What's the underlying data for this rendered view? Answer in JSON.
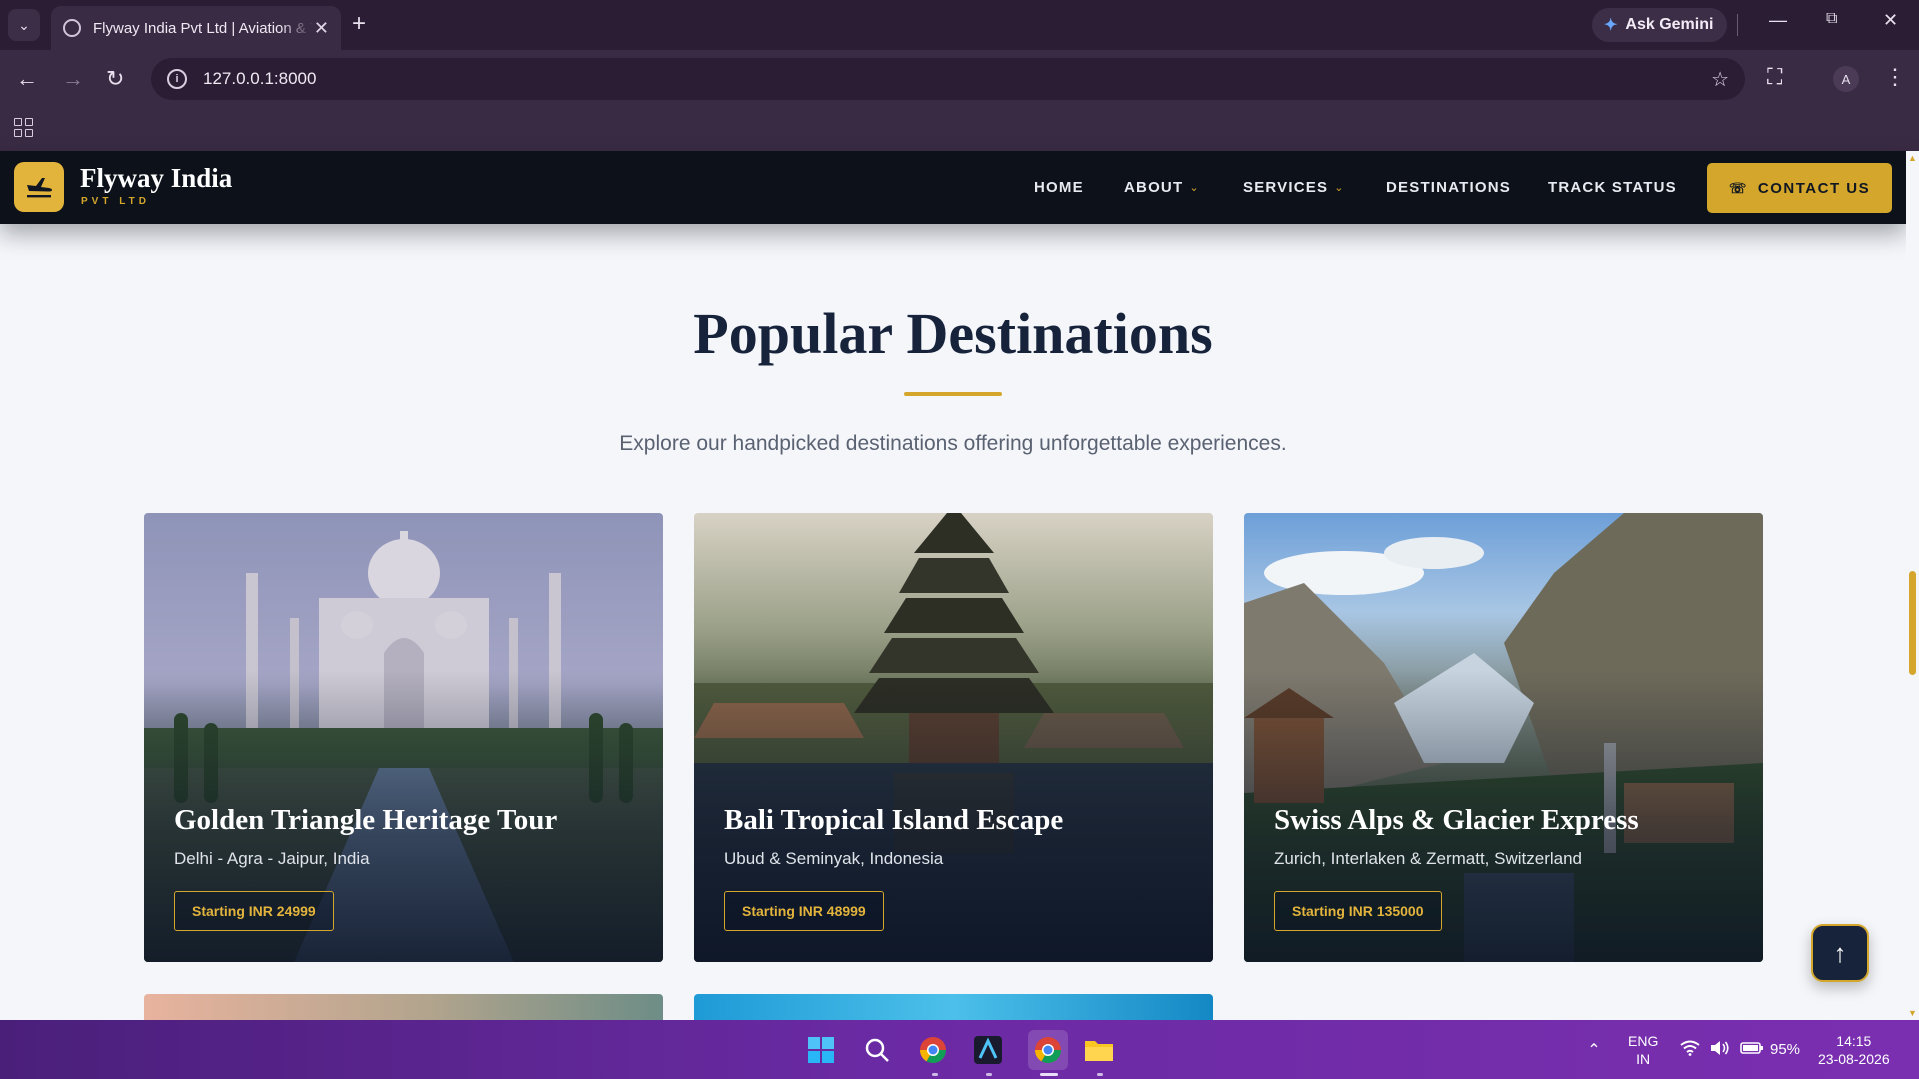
{
  "browser": {
    "tab_title": "Flyway India Pvt Ltd | Aviation & Travel",
    "url": "127.0.0.1:8000",
    "gemini_label": "Ask Gemini",
    "profile_initial": "A"
  },
  "site": {
    "brand_name": "Flyway India",
    "brand_sub": "PVT LTD",
    "nav": {
      "home": "HOME",
      "about": "ABOUT",
      "services": "SERVICES",
      "destinations": "DESTINATIONS",
      "track": "TRACK STATUS"
    },
    "contact_label": "CONTACT US",
    "accent_color": "#d4a72c",
    "dark_color": "#0c111a"
  },
  "section": {
    "title": "Popular Destinations",
    "subtitle": "Explore our handpicked destinations offering unforgettable experiences."
  },
  "cards": [
    {
      "title": "Golden Triangle Heritage Tour",
      "location": "Delhi - Agra - Jaipur, India",
      "price": "Starting INR 24999"
    },
    {
      "title": "Bali Tropical Island Escape",
      "location": "Ubud & Seminyak, Indonesia",
      "price": "Starting INR 48999"
    },
    {
      "title": "Swiss Alps & Glacier Express",
      "location": "Zurich, Interlaken & Zermatt, Switzerland",
      "price": "Starting INR 135000"
    }
  ],
  "taskbar": {
    "lang_line1": "ENG",
    "lang_line2": "IN",
    "battery": "95%",
    "time": "14:15",
    "date": "23-08-2026"
  }
}
